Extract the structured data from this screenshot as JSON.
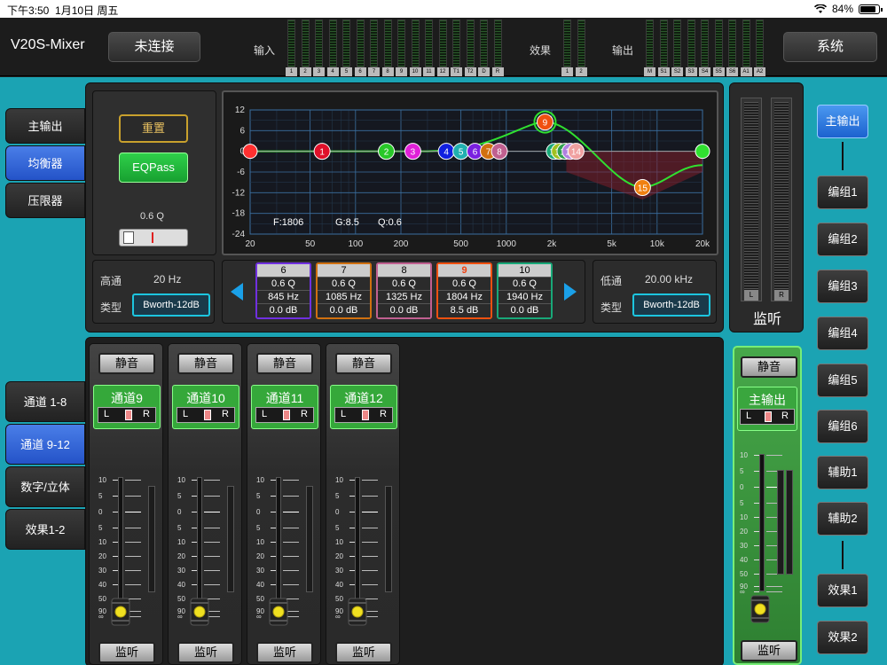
{
  "status": {
    "time": "下午3:50",
    "date": "1月10日 周五",
    "battery": "84%"
  },
  "header": {
    "app_title": "V20S-Mixer",
    "connect_label": "未连接",
    "input_label": "输入",
    "effect_label": "效果",
    "output_label": "输出",
    "system_label": "系统",
    "input_meters": [
      "1",
      "2",
      "3",
      "4",
      "5",
      "6",
      "7",
      "8",
      "9",
      "10",
      "11",
      "12",
      "T1",
      "T2",
      "D",
      "R"
    ],
    "effect_meters": [
      "1",
      "2"
    ],
    "output_meters": [
      "M",
      "S1",
      "S2",
      "S3",
      "S4",
      "S5",
      "S6",
      "A1",
      "A2"
    ]
  },
  "side_tabs": [
    "主输出",
    "均衡器",
    "压限器"
  ],
  "channel_tabs": [
    "通道 1-8",
    "通道 9-12",
    "数字/立体",
    "效果1-2"
  ],
  "eq": {
    "reset_label": "重置",
    "eqpass_label": "EQPass",
    "q_readout": "0.6 Q",
    "y_ticks": [
      "12",
      "6",
      "0",
      "-6",
      "-12",
      "-18",
      "-24"
    ],
    "x_ticks": [
      "20",
      "50",
      "100",
      "200",
      "500",
      "1000",
      "2k",
      "5k",
      "10k",
      "20k"
    ],
    "readout_f": "F:1806",
    "readout_g": "G:8.5",
    "readout_q": "Q:0.6",
    "nodes": [
      {
        "label": "1",
        "color": "#e0102a"
      },
      {
        "label": "2",
        "color": "#28c828"
      },
      {
        "label": "3",
        "color": "#e020d8"
      },
      {
        "label": "4",
        "color": "#1020e0"
      },
      {
        "label": "5",
        "color": "#20b0b0"
      },
      {
        "label": "6",
        "color": "#7a20e0"
      },
      {
        "label": "7",
        "color": "#d07010"
      },
      {
        "label": "8",
        "color": "#c06090"
      },
      {
        "label": "9",
        "color": "#f05010"
      },
      {
        "label": "10",
        "color": "#18a878"
      },
      {
        "label": "11",
        "color": "#a0c020"
      },
      {
        "label": "12",
        "color": "#30a050"
      },
      {
        "label": "13",
        "color": "#b080e0"
      },
      {
        "label": "14",
        "color": "#f0a0a0"
      },
      {
        "label": "15",
        "color": "#f08010"
      }
    ],
    "highpass": {
      "label": "高通",
      "freq": "20 Hz",
      "type_label": "类型",
      "type": "Bworth-12dB"
    },
    "lowpass": {
      "label": "低通",
      "freq": "20.00 kHz",
      "type_label": "类型",
      "type": "Bworth-12dB"
    },
    "bands": [
      {
        "num": "6",
        "q": "0.6 Q",
        "freq": "845 Hz",
        "gain": "0.0 dB",
        "color": "#7030e0"
      },
      {
        "num": "7",
        "q": "0.6 Q",
        "freq": "1085 Hz",
        "gain": "0.0 dB",
        "color": "#d07010"
      },
      {
        "num": "8",
        "q": "0.6 Q",
        "freq": "1325 Hz",
        "gain": "0.0 dB",
        "color": "#c06090"
      },
      {
        "num": "9",
        "q": "0.6 Q",
        "freq": "1804 Hz",
        "gain": "8.5 dB",
        "color": "#f05010"
      },
      {
        "num": "10",
        "q": "0.6 Q",
        "freq": "1940 Hz",
        "gain": "0.0 dB",
        "color": "#18a878"
      }
    ]
  },
  "channels": [
    {
      "name": "通道9",
      "mute": "静音",
      "monitor": "监听"
    },
    {
      "name": "通道10",
      "mute": "静音",
      "monitor": "监听"
    },
    {
      "name": "通道11",
      "mute": "静音",
      "monitor": "监听"
    },
    {
      "name": "通道12",
      "mute": "静音",
      "monitor": "监听"
    }
  ],
  "fader_scale": [
    "10",
    "5",
    "0",
    "5",
    "10",
    "20",
    "30",
    "40",
    "50",
    "90",
    "∞"
  ],
  "lr": {
    "l": "L",
    "r": "R"
  },
  "monitor": {
    "title": "监听",
    "l": "L",
    "r": "R"
  },
  "master": {
    "name": "主输出",
    "mute": "静音",
    "monitor": "监听"
  },
  "bus_buttons": [
    "主输出",
    "编组1",
    "编组2",
    "编组3",
    "编组4",
    "编组5",
    "编组6",
    "辅助1",
    "辅助2",
    "效果1",
    "效果2"
  ]
}
